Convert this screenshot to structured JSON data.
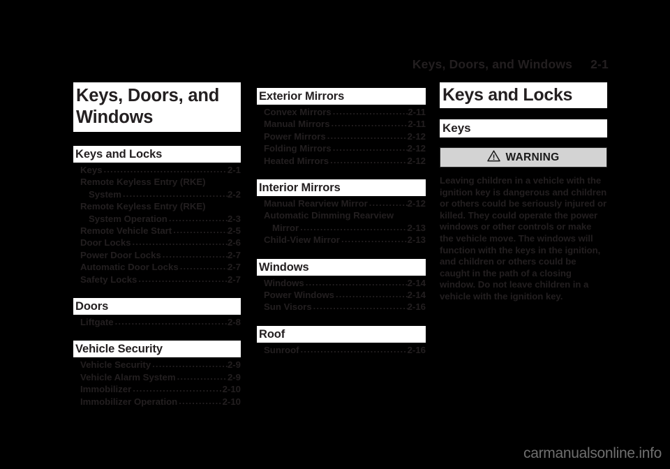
{
  "header": {
    "title": "Keys, Doors, and Windows",
    "page_number": "2-1"
  },
  "chapter": {
    "title": "Keys, Doors, and Windows"
  },
  "left_column": {
    "sections": [
      {
        "heading": "Keys and Locks",
        "entries": [
          {
            "label": "Keys",
            "page": "2-1"
          },
          {
            "label": "Remote Keyless Entry (RKE)",
            "cont": "System",
            "page": "2-2"
          },
          {
            "label": "Remote Keyless Entry (RKE)",
            "cont": "System Operation",
            "page": "2-3"
          },
          {
            "label": "Remote Vehicle Start",
            "page": "2-5"
          },
          {
            "label": "Door Locks",
            "page": "2-6"
          },
          {
            "label": "Power Door Locks",
            "page": "2-7"
          },
          {
            "label": "Automatic Door Locks",
            "page": "2-7"
          },
          {
            "label": "Safety Locks",
            "page": "2-7"
          }
        ]
      },
      {
        "heading": "Doors",
        "entries": [
          {
            "label": "Liftgate",
            "page": "2-8"
          }
        ]
      },
      {
        "heading": "Vehicle Security",
        "entries": [
          {
            "label": "Vehicle Security",
            "page": "2-9"
          },
          {
            "label": "Vehicle Alarm System",
            "page": "2-9"
          },
          {
            "label": "Immobilizer",
            "page": "2-10"
          },
          {
            "label": "Immobilizer Operation",
            "page": "2-10"
          }
        ]
      }
    ]
  },
  "middle_column": {
    "sections": [
      {
        "heading": "Exterior Mirrors",
        "entries": [
          {
            "label": "Convex Mirrors",
            "page": "2-11"
          },
          {
            "label": "Manual Mirrors",
            "page": "2-11"
          },
          {
            "label": "Power Mirrors",
            "page": "2-12"
          },
          {
            "label": "Folding Mirrors",
            "page": "2-12"
          },
          {
            "label": "Heated Mirrors",
            "page": "2-12"
          }
        ]
      },
      {
        "heading": "Interior Mirrors",
        "entries": [
          {
            "label": "Manual Rearview Mirror",
            "page": "2-12"
          },
          {
            "label": "Automatic Dimming Rearview",
            "cont": "Mirror",
            "page": "2-13"
          },
          {
            "label": "Child-View Mirror",
            "page": "2-13"
          }
        ]
      },
      {
        "heading": "Windows",
        "entries": [
          {
            "label": "Windows",
            "page": "2-14"
          },
          {
            "label": "Power Windows",
            "page": "2-14"
          },
          {
            "label": "Sun Visors",
            "page": "2-16"
          }
        ]
      },
      {
        "heading": "Roof",
        "entries": [
          {
            "label": "Sunroof",
            "page": "2-16"
          }
        ]
      }
    ]
  },
  "right_column": {
    "article_title": "Keys and Locks",
    "article_subtitle": "Keys",
    "warning": {
      "icon": "warning-triangle-icon",
      "label": "WARNING",
      "body": "Leaving children in a vehicle with the ignition key is dangerous and children or others could be seriously injured or killed. They could operate the power windows or other controls or make the vehicle move. The windows will function with the keys in the ignition, and children or others could be caught in the path of a closing window. Do not leave children in a vehicle with the ignition key.",
      "background_color": "#d3d3d3"
    }
  },
  "watermark": {
    "text": "carmanualsonline.info"
  },
  "colors": {
    "page_background": "#000000",
    "band_background": "#ffffff",
    "ink": "#231f20",
    "watermark": "#6f6f6f"
  },
  "dot_leader": "................................................."
}
